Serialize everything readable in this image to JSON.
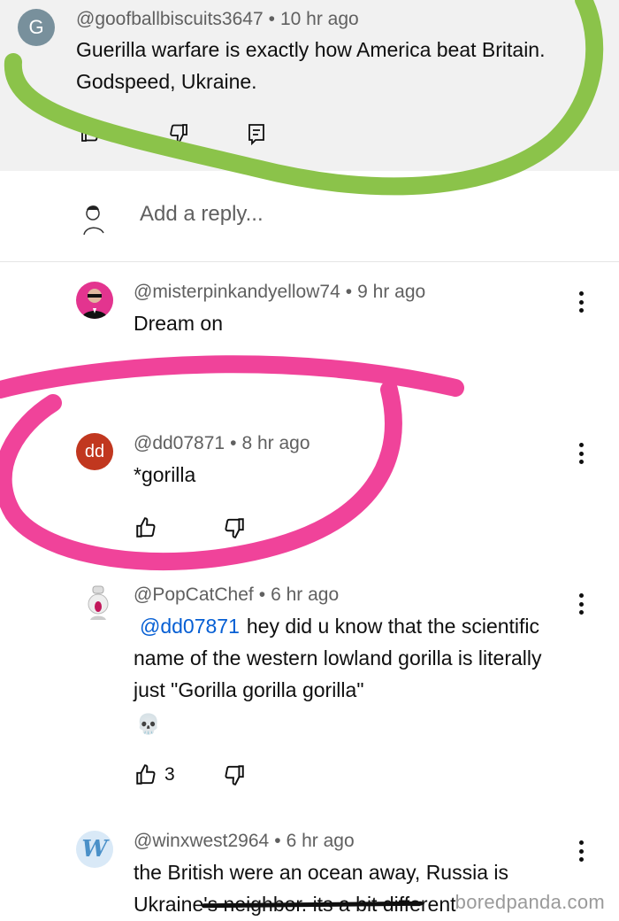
{
  "comments": [
    {
      "avatar_letter": "G",
      "handle": "@goofballbiscuits3647",
      "time": "10 hr ago",
      "text": "Guerilla warfare is exactly how America beat Britain. Godspeed, Ukraine."
    },
    {
      "handle": "@misterpinkandyellow74",
      "time": "9 hr ago",
      "text": "Dream on"
    },
    {
      "avatar_letter": "dd",
      "handle": "@dd07871",
      "time": "8 hr ago",
      "text": "*gorilla"
    },
    {
      "handle": "@PopCatChef",
      "time": "6 hr ago",
      "mention": "@dd07871",
      "text": "hey did u know that the scientific name of the western lowland gorilla is literally just \"Gorilla gorilla gorilla\"",
      "emoji": "💀",
      "likes": "3"
    },
    {
      "avatar_letter": "W",
      "handle": "@winxwest2964",
      "time": "6 hr ago",
      "text_before": "the British were an ocean away, Russia is Ukraine",
      "text_struck": "'s neighbor. its a bit",
      "text_after": " different"
    }
  ],
  "reply_placeholder": "Add a reply...",
  "separator": "•",
  "watermark": "boredpanda.com",
  "colors": {
    "highlight_green": "#8bc34a",
    "highlight_pink": "#f0439a",
    "mention_blue": "#065fd4"
  },
  "icons": [
    "thumbs-up-icon",
    "thumbs-down-icon",
    "reply-icon",
    "more-vert-icon",
    "skull-emoji"
  ]
}
